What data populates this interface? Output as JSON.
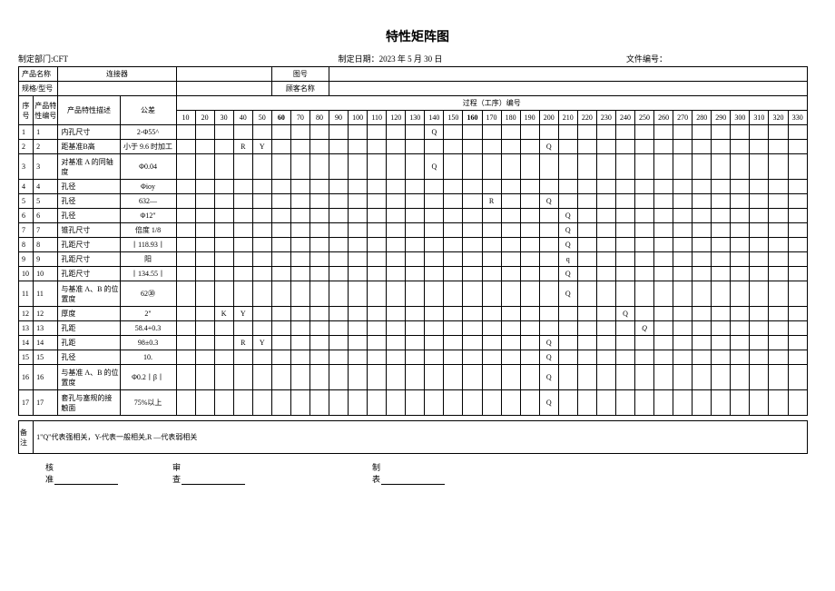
{
  "title": "特性矩阵图",
  "meta": {
    "dept_label": "制定部门:",
    "dept": "CFT",
    "date_label": "制定日期：",
    "date": "2023 年 5 月 30 日",
    "doc_no_label": "文件编号：",
    "doc_no": ""
  },
  "head": {
    "product_name_label": "产品名称",
    "product_name": "连接器",
    "drawing_no_label": "图号",
    "spec_label": "规格/型号",
    "customer_label": "顾客名称",
    "seq_label": "序号",
    "feature_no_label": "产品特性编号",
    "feature_desc_label": "产品特性描述",
    "tolerance_label": "公差",
    "process_label": "过程（工序）编号",
    "cols": [
      "10",
      "20",
      "30",
      "40",
      "50",
      "60",
      "70",
      "80",
      "90",
      "100",
      "110",
      "120",
      "130",
      "140",
      "150",
      "160",
      "170",
      "180",
      "190",
      "200",
      "210",
      "220",
      "230",
      "240",
      "250",
      "260",
      "270",
      "280",
      "290",
      "300",
      "310",
      "320",
      "330"
    ],
    "bold_cols": [
      "60",
      "160"
    ]
  },
  "rows": [
    {
      "seq": "1",
      "no": "1",
      "desc": "内孔尺寸",
      "tol": "2-Φ55^",
      "marks": {
        "140": "Q"
      }
    },
    {
      "seq": "2",
      "no": "2",
      "desc": "距基准B高",
      "tol": "小于 9.6 时加工",
      "marks": {
        "40": "R",
        "50": "Y",
        "200": "Q"
      }
    },
    {
      "seq": "3",
      "no": "3",
      "desc": "对基准 A 的同轴度",
      "tol": "Φ0.04",
      "tall": true,
      "marks": {
        "140": "Q"
      }
    },
    {
      "seq": "4",
      "no": "4",
      "desc": "孔径",
      "tol": "Φioy"
    },
    {
      "seq": "5",
      "no": "5",
      "desc": "孔径",
      "tol": "632—",
      "marks": {
        "170": "R",
        "200": "Q"
      }
    },
    {
      "seq": "6",
      "no": "6",
      "desc": "孔径",
      "tol": "Φ12\"",
      "marks": {
        "210": "Q"
      }
    },
    {
      "seq": "7",
      "no": "7",
      "desc": "锥孔尺寸",
      "tol": "倍度 1/8",
      "marks": {
        "210": "Q"
      }
    },
    {
      "seq": "8",
      "no": "8",
      "desc": "孔距尺寸",
      "tol": "丨118.93丨",
      "marks": {
        "210": "Q"
      }
    },
    {
      "seq": "9",
      "no": "9",
      "desc": "孔距尺寸",
      "tol": "阳",
      "marks": {
        "210": "q"
      }
    },
    {
      "seq": "10",
      "no": "10",
      "desc": "孔距尺寸",
      "tol": "丨134.55丨",
      "marks": {
        "210": "Q"
      }
    },
    {
      "seq": "11",
      "no": "11",
      "desc": "与基准 A、B 的位置度",
      "tol": "62㉚",
      "tall": true,
      "marks": {
        "210": "Q"
      }
    },
    {
      "seq": "12",
      "no": "12",
      "desc": "厚度",
      "tol": "2\"",
      "marks": {
        "30": "K",
        "40": "Y",
        "240": "Q"
      }
    },
    {
      "seq": "13",
      "no": "13",
      "desc": "孔距",
      "tol": "58.4+0.3",
      "marks": {
        "250": "Q",
        "250_italic": true
      }
    },
    {
      "seq": "14",
      "no": "14",
      "desc": "孔距",
      "tol": "98±0.3",
      "marks": {
        "40": "R",
        "50": "Y",
        "200": "Q"
      }
    },
    {
      "seq": "15",
      "no": "15",
      "desc": "孔径",
      "tol": "10.",
      "marks": {
        "200": "Q"
      }
    },
    {
      "seq": "16",
      "no": "16",
      "desc": "与基准 A、B 的位置度",
      "tol": "Φ0.2丨β丨",
      "tall": true,
      "marks": {
        "200": "Q"
      }
    },
    {
      "seq": "17",
      "no": "17",
      "desc": "套孔与塞规的接触面",
      "tol": "75%以上",
      "tall": true,
      "marks": {
        "200": "Q"
      }
    }
  ],
  "notes": {
    "label": "备注",
    "text": "1\"Q\"代表强相关，Y-代表一般相关,R —代表弱相关"
  },
  "footer": {
    "approve": "核准",
    "check": "审查",
    "make": "制表"
  }
}
